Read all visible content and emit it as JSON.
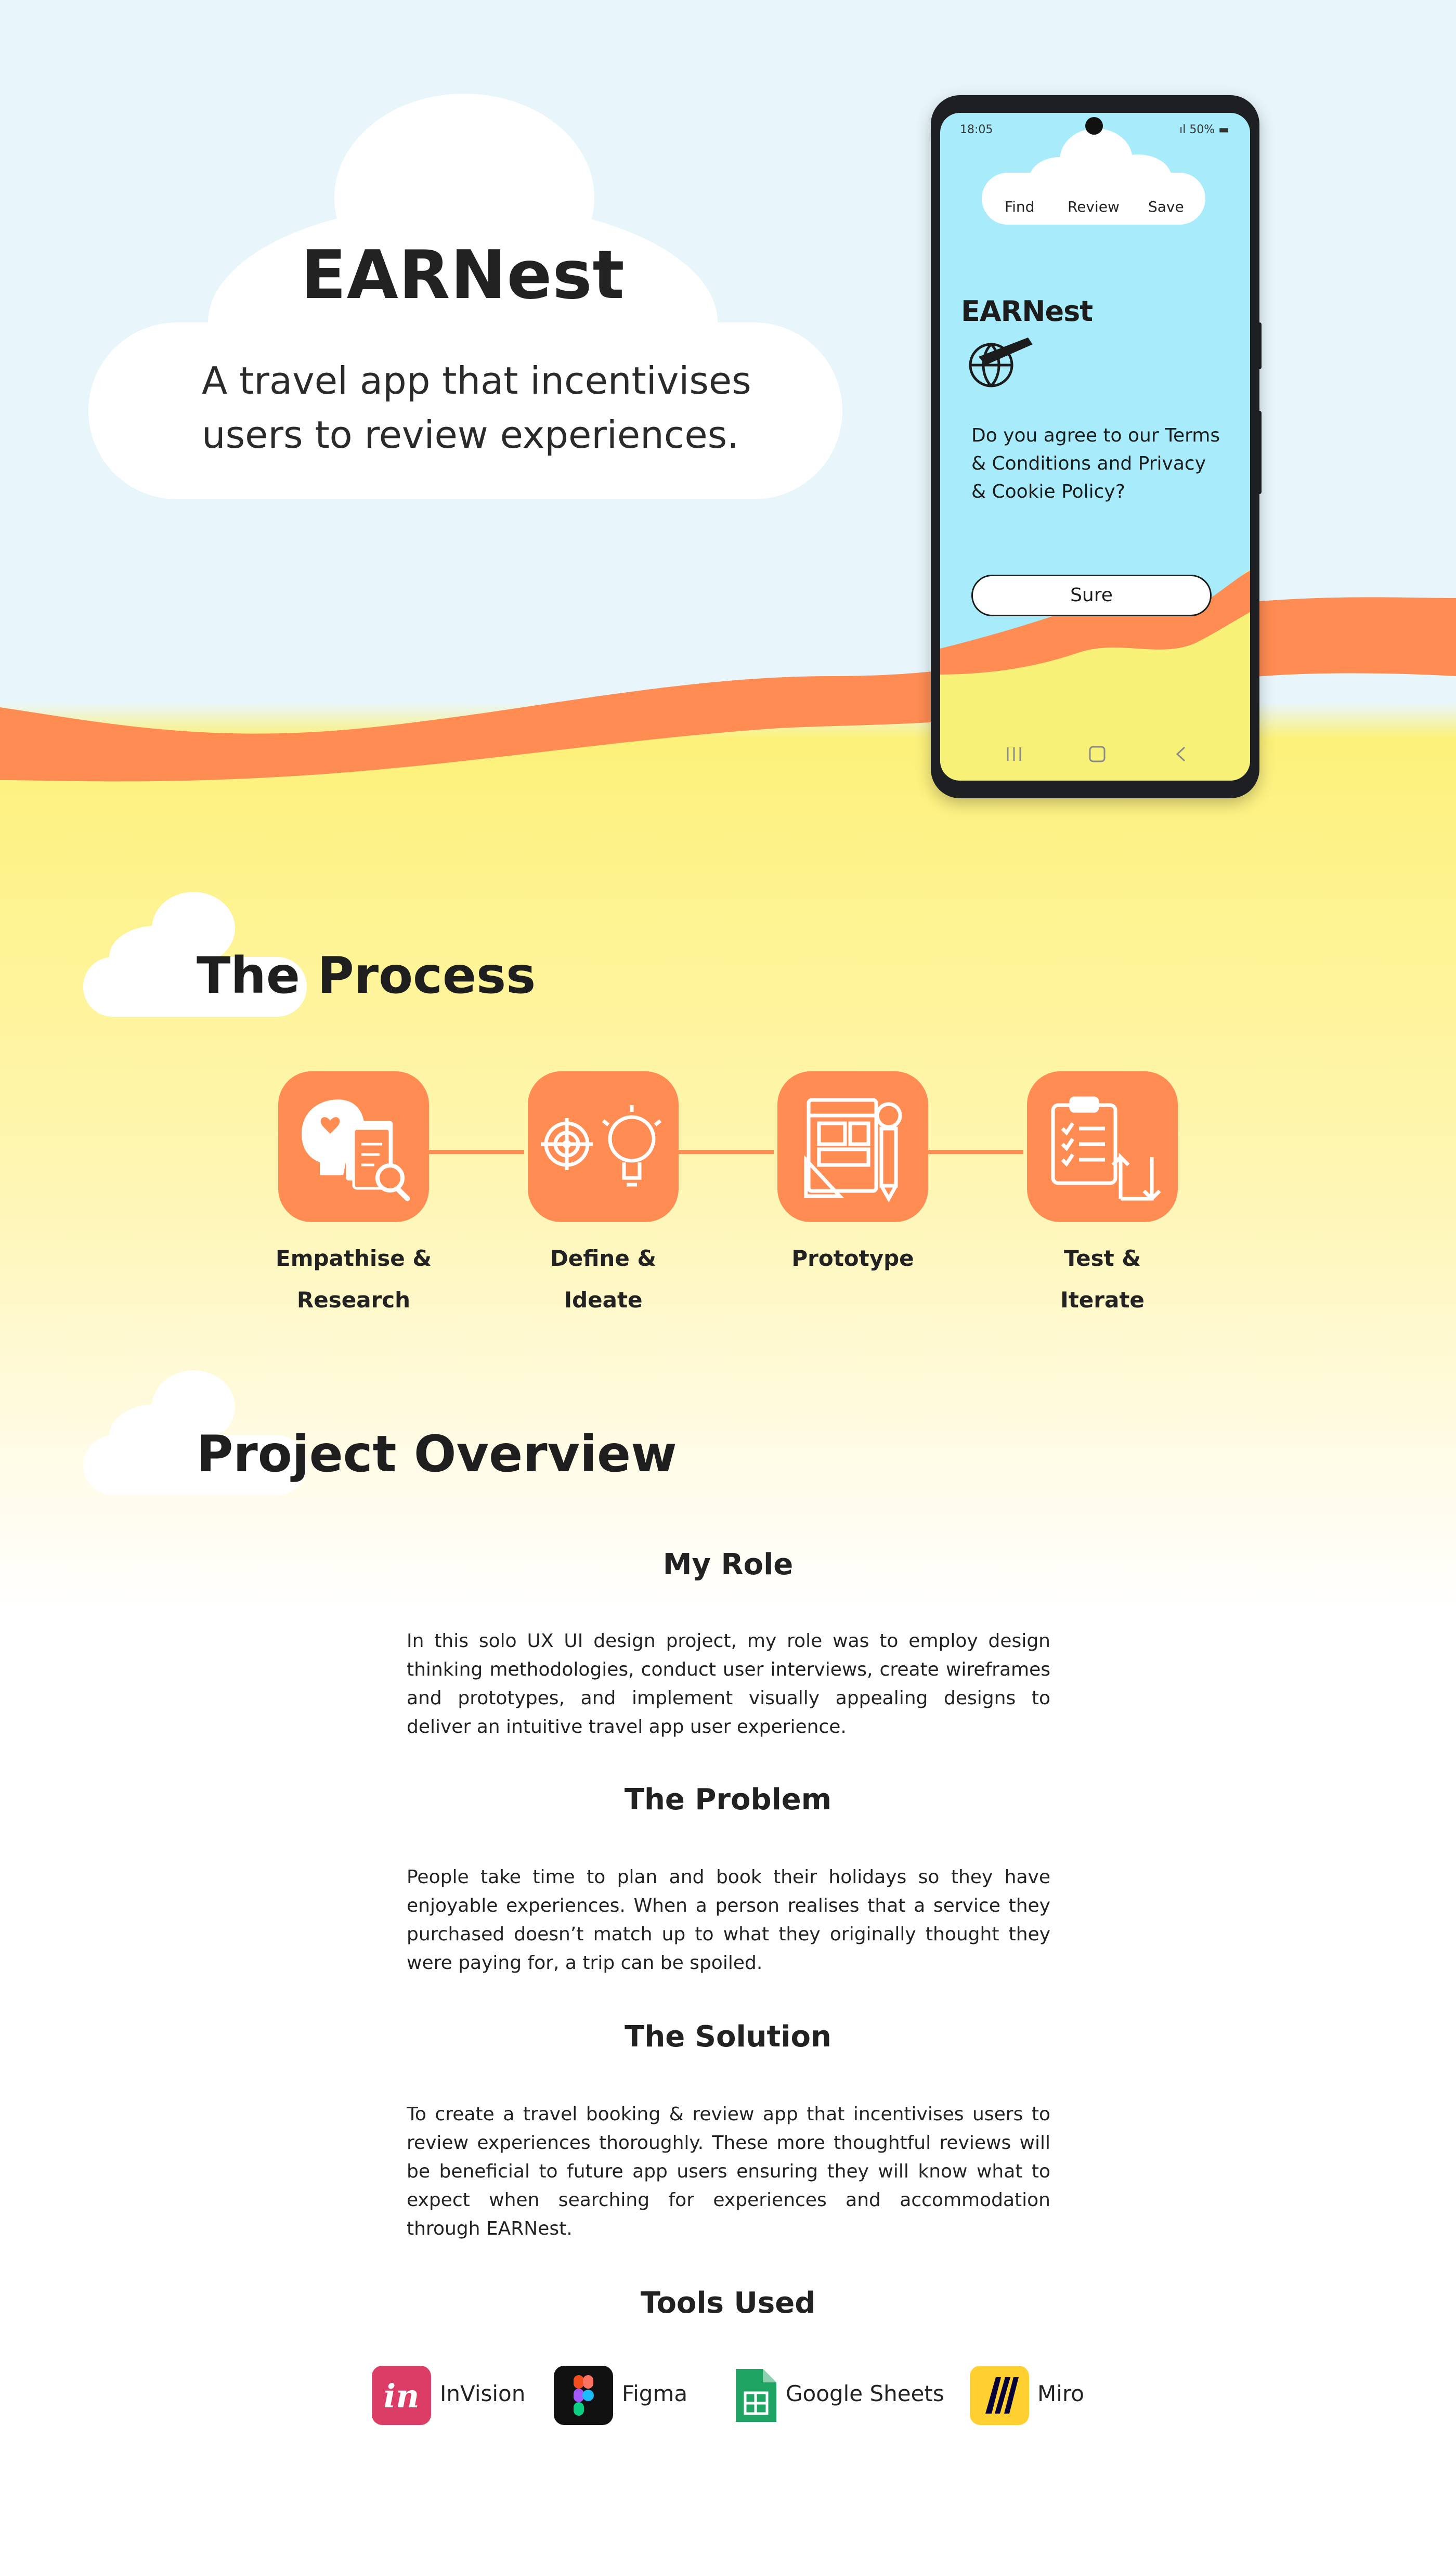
{
  "hero": {
    "title": "EARNest",
    "subtitle_line1": "A travel app that incentivises",
    "subtitle_line2": "users to review experiences."
  },
  "phone": {
    "status_time": "18:05",
    "status_battery": "50%",
    "nav": [
      "Find",
      "Review",
      "Save"
    ],
    "logo_text": "EARNest",
    "consent_text": "Do you agree to our Terms & Conditions and Privacy & Cookie Policy?",
    "button_label": "Sure"
  },
  "process": {
    "title": "The Process",
    "steps": [
      {
        "line1": "Empathise &",
        "line2": "Research"
      },
      {
        "line1": "Define & Ideate",
        "line2": ""
      },
      {
        "line1": "Prototype",
        "line2": ""
      },
      {
        "line1": "Test & Iterate",
        "line2": ""
      }
    ]
  },
  "overview": {
    "title": "Project Overview",
    "role_title": "My Role",
    "role_text": "In this solo UX UI design project, my role was to employ design thinking methodologies, conduct user interviews, create wireframes and prototypes, and implement visually appealing designs to deliver an intuitive travel app user experience.",
    "problem_title": "The Problem",
    "problem_text": "People take time to plan and book their holidays so they have enjoyable experiences. When a person realises that a service they purchased doesn’t match up to what they originally thought they were paying for, a trip can be spoiled.",
    "solution_title": "The Solution",
    "solution_text": "To create a travel booking & review app that incentivises users to review experiences thoroughly. These more thoughtful reviews will be beneficial to future app users ensuring they will know what to expect when searching for experiences and accommodation through EARNest.",
    "tools_title": "Tools Used",
    "tools": [
      "InVision",
      "Figma",
      "Google Sheets",
      "Miro"
    ]
  },
  "colors": {
    "accent": "#ff8c52",
    "sky": "#e8f6fb",
    "sand": "#fdf17a",
    "screen": "#a8ecfb"
  }
}
